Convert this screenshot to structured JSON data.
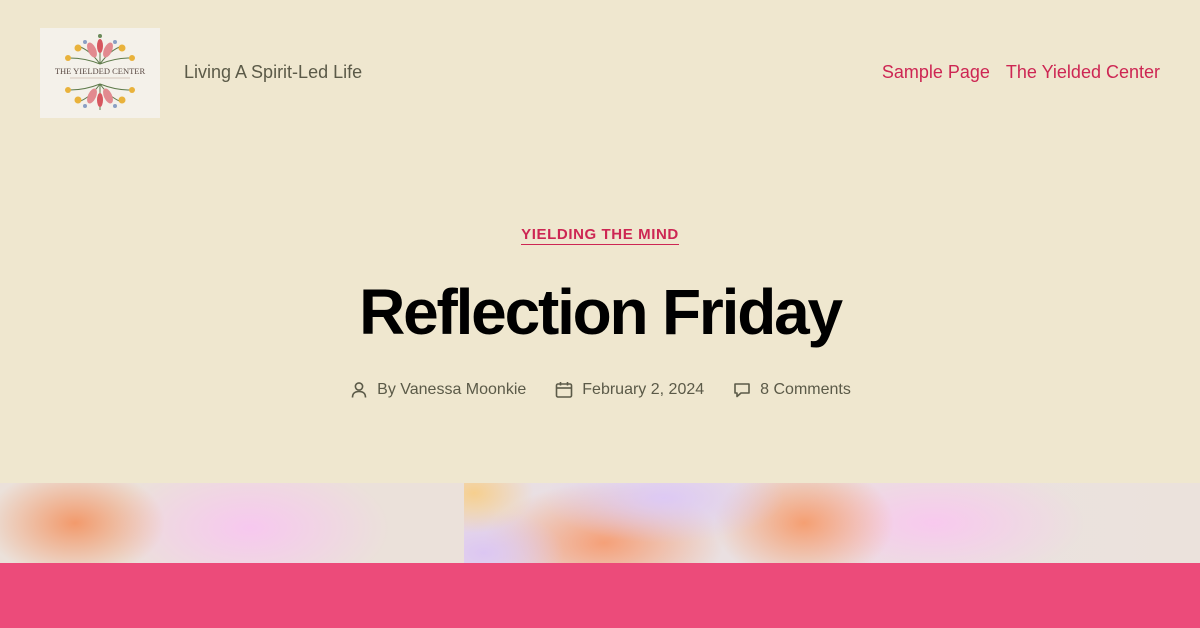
{
  "site": {
    "logo_text": "THE YIELDED CENTER",
    "tagline": "Living A Spirit-Led Life"
  },
  "nav": {
    "items": [
      {
        "label": "Sample Page"
      },
      {
        "label": "The Yielded Center"
      }
    ]
  },
  "post": {
    "category": "YIELDING THE MIND",
    "title": "Reflection Friday",
    "meta": {
      "author": "By Vanessa Moonkie",
      "date": "February 2, 2024",
      "comments": "8 Comments"
    }
  },
  "colors": {
    "background": "#efe7cf",
    "accent": "#cd2653",
    "text_muted": "#5b5a48",
    "title": "#000000",
    "band": "#ec4b7a"
  },
  "icons": {
    "author": "person-icon",
    "date": "calendar-icon",
    "comments": "comment-bubble-icon"
  }
}
